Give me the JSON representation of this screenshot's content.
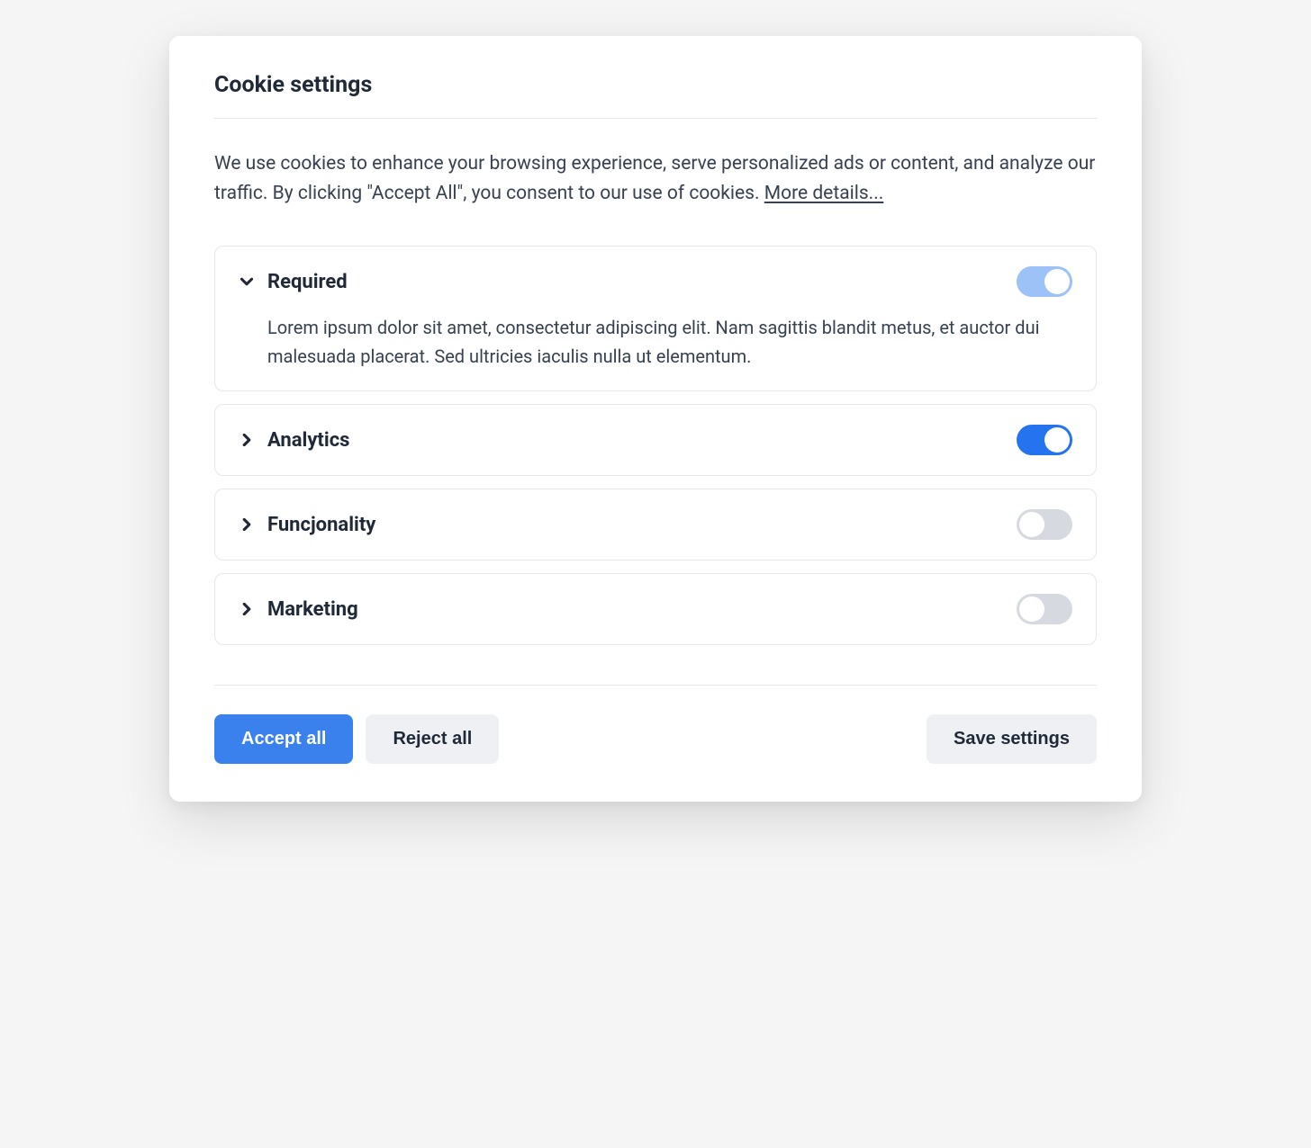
{
  "title": "Cookie settings",
  "description_text": "We use cookies to enhance your browsing experience, serve personalized ads or content, and analyze our traffic. By clicking \"Accept All\", you consent to our use of cookies. ",
  "more_details_label": "More details...",
  "categories": [
    {
      "label": "Required",
      "expanded": true,
      "toggle_state": "disabled-on",
      "body": "Lorem ipsum dolor sit amet, consectetur adipiscing elit. Nam sagittis blandit metus, et auctor dui malesuada placerat. Sed ultricies iaculis nulla ut elementum."
    },
    {
      "label": "Analytics",
      "expanded": false,
      "toggle_state": "on",
      "body": ""
    },
    {
      "label": "Funcjonality",
      "expanded": false,
      "toggle_state": "off",
      "body": ""
    },
    {
      "label": "Marketing",
      "expanded": false,
      "toggle_state": "off",
      "body": ""
    }
  ],
  "buttons": {
    "accept_all": "Accept all",
    "reject_all": "Reject all",
    "save_settings": "Save settings"
  }
}
